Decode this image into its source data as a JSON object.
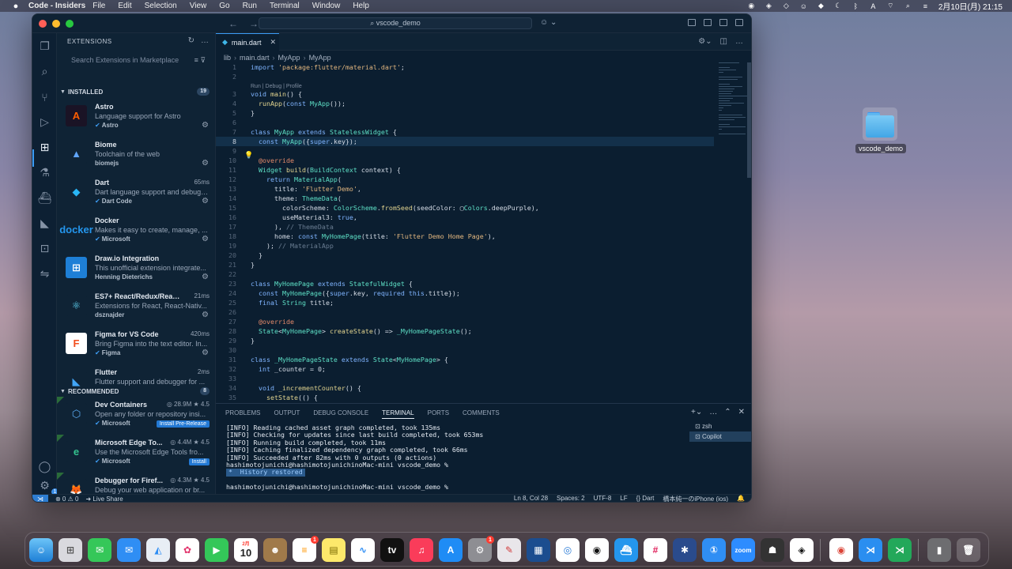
{
  "menubar": {
    "app_name": "Code - Insiders",
    "items": [
      "File",
      "Edit",
      "Selection",
      "View",
      "Go",
      "Run",
      "Terminal",
      "Window",
      "Help"
    ],
    "clock": "2月10日(月) 21:15"
  },
  "desktop": {
    "folder_label": "vscode_demo"
  },
  "titlebar": {
    "search_text": "vscode_demo"
  },
  "sidebar": {
    "title": "EXTENSIONS",
    "search_placeholder": "Search Extensions in Marketplace",
    "installed_label": "INSTALLED",
    "installed_count": "19",
    "recommended_label": "RECOMMENDED",
    "recommended_count": "8",
    "installed": [
      {
        "name": "Astro",
        "desc": "Language support for Astro",
        "publisher": "Astro",
        "verified": true,
        "meta": "",
        "logo": "A",
        "logo_bg": "#1a1325",
        "logo_fg": "#ff5d01"
      },
      {
        "name": "Biome",
        "desc": "Toolchain of the web",
        "publisher": "biomejs",
        "verified": false,
        "meta": "",
        "logo": "▲",
        "logo_bg": "#0f2335",
        "logo_fg": "#60a5fa"
      },
      {
        "name": "Dart",
        "desc": "Dart language support and debugg...",
        "publisher": "Dart Code",
        "verified": true,
        "meta": "65ms",
        "logo": "◆",
        "logo_bg": "#0f2335",
        "logo_fg": "#29b6f6"
      },
      {
        "name": "Docker",
        "desc": "Makes it easy to create, manage, ...",
        "publisher": "Microsoft",
        "verified": true,
        "meta": "",
        "logo": "docker",
        "logo_bg": "#0f2335",
        "logo_fg": "#2496ed"
      },
      {
        "name": "Draw.io Integration",
        "desc": "This unofficial extension integrate...",
        "publisher": "Henning Dieterichs",
        "verified": false,
        "meta": "",
        "logo": "⊞",
        "logo_bg": "#1e7fd6",
        "logo_fg": "#ffffff"
      },
      {
        "name": "ES7+ React/Redux/React...",
        "desc": "Extensions for React, React-Nativ...",
        "publisher": "dsznajder",
        "verified": false,
        "meta": "21ms",
        "logo": "⚛",
        "logo_bg": "#0f2335",
        "logo_fg": "#61dafb"
      },
      {
        "name": "Figma for VS Code",
        "desc": "Bring Figma into the text editor. In...",
        "publisher": "Figma",
        "verified": true,
        "meta": "420ms",
        "logo": "F",
        "logo_bg": "#ffffff",
        "logo_fg": "#f24e1e"
      },
      {
        "name": "Flutter",
        "desc": "Flutter support and debugger for ...",
        "publisher": "",
        "verified": false,
        "meta": "2ms",
        "logo": "◣",
        "logo_bg": "#0f2335",
        "logo_fg": "#42a5f5"
      }
    ],
    "recommended": [
      {
        "name": "Dev Containers",
        "desc": "Open any folder or repository insi...",
        "publisher": "Microsoft",
        "verified": true,
        "meta": "◎ 28.9M ★ 4.5",
        "install": "Install Pre-Release",
        "logo": "⬡",
        "logo_bg": "#0f2335",
        "logo_fg": "#5aa9f0"
      },
      {
        "name": "Microsoft Edge To...",
        "desc": "Use the Microsoft Edge Tools fro...",
        "publisher": "Microsoft",
        "verified": true,
        "meta": "◎ 4.4M ★ 4.5",
        "install": "Install",
        "logo": "e",
        "logo_bg": "#0f2335",
        "logo_fg": "#34c38f"
      },
      {
        "name": "Debugger for Firef...",
        "desc": "Debug your web application or br...",
        "publisher": "Firefox DevTools",
        "verified": false,
        "meta": "◎ 4.3M ★ 4.5",
        "install": "Install",
        "logo": "🦊",
        "logo_bg": "#0f2335",
        "logo_fg": "#ff7139"
      }
    ]
  },
  "editor": {
    "tab_label": "main.dart",
    "breadcrumb": [
      "lib",
      "main.dart",
      "MyApp",
      "MyApp"
    ],
    "codelens": "Run | Debug | Profile",
    "lines": [
      {
        "n": "1",
        "html": "<span class='kw'>import</span> <span class='str'>'package:flutter/material.dart'</span>;"
      },
      {
        "n": "2",
        "html": ""
      },
      {
        "n": "3",
        "html": "<span class='kw'>void</span> <span class='fn'>main</span>() {"
      },
      {
        "n": "4",
        "html": "  <span class='fn'>runApp</span>(<span class='kw'>const</span> <span class='cls'>MyApp</span>());"
      },
      {
        "n": "5",
        "html": "}"
      },
      {
        "n": "6",
        "html": ""
      },
      {
        "n": "7",
        "html": "<span class='kw'>class</span> <span class='cls'>MyApp</span> <span class='kw'>extends</span> <span class='cls'>StatelessWidget</span> {"
      },
      {
        "n": "8",
        "html": "  <span class='kw'>const</span> <span class='cls'>MyApp</span>({<span class='kw'>super</span>.key});"
      },
      {
        "n": "9",
        "html": ""
      },
      {
        "n": "10",
        "html": "  <span class='ann'>@override</span>"
      },
      {
        "n": "11",
        "html": "  <span class='cls'>Widget</span> <span class='fn'>build</span>(<span class='cls'>BuildContext</span> context) {"
      },
      {
        "n": "12",
        "html": "    <span class='kw'>return</span> <span class='cls'>MaterialApp</span>("
      },
      {
        "n": "13",
        "html": "      title: <span class='str'>'Flutter Demo'</span>,"
      },
      {
        "n": "14",
        "html": "      theme: <span class='cls'>ThemeData</span>("
      },
      {
        "n": "15",
        "html": "        colorScheme: <span class='cls'>ColorScheme</span>.<span class='fn'>fromSeed</span>(seedColor: ▢<span class='cls'>Colors</span>.deepPurple),"
      },
      {
        "n": "16",
        "html": "        useMaterial3: <span class='kw'>true</span>,"
      },
      {
        "n": "17",
        "html": "      ), <span class='cm'>// ThemeData</span>"
      },
      {
        "n": "18",
        "html": "      home: <span class='kw'>const</span> <span class='cls'>MyHomePage</span>(title: <span class='str'>'Flutter Demo Home Page'</span>),"
      },
      {
        "n": "19",
        "html": "    ); <span class='cm'>// MaterialApp</span>"
      },
      {
        "n": "20",
        "html": "  }"
      },
      {
        "n": "21",
        "html": "}"
      },
      {
        "n": "22",
        "html": ""
      },
      {
        "n": "23",
        "html": "<span class='kw'>class</span> <span class='cls'>MyHomePage</span> <span class='kw'>extends</span> <span class='cls'>StatefulWidget</span> {"
      },
      {
        "n": "24",
        "html": "  <span class='kw'>const</span> <span class='cls'>MyHomePage</span>({<span class='kw'>super</span>.key, <span class='kw'>required</span> <span class='kw'>this</span>.title});"
      },
      {
        "n": "25",
        "html": "  <span class='kw'>final</span> <span class='cls'>String</span> title;"
      },
      {
        "n": "26",
        "html": ""
      },
      {
        "n": "27",
        "html": "  <span class='ann'>@override</span>"
      },
      {
        "n": "28",
        "html": "  <span class='cls'>State</span>&lt;<span class='cls'>MyHomePage</span>&gt; <span class='fn'>createState</span>() =&gt; <span class='cls'>_MyHomePageState</span>();"
      },
      {
        "n": "29",
        "html": "}"
      },
      {
        "n": "30",
        "html": ""
      },
      {
        "n": "31",
        "html": "<span class='kw'>class</span> <span class='cls'>_MyHomePageState</span> <span class='kw'>extends</span> <span class='cls'>State</span>&lt;<span class='cls'>MyHomePage</span>&gt; {"
      },
      {
        "n": "32",
        "html": "  <span class='kw'>int</span> _counter = 0;"
      },
      {
        "n": "33",
        "html": ""
      },
      {
        "n": "34",
        "html": "  <span class='kw'>void</span> <span class='fn'>_incrementCounter</span>() {"
      },
      {
        "n": "35",
        "html": "    <span class='fn'>setState</span>(() {"
      }
    ]
  },
  "panel": {
    "tabs": [
      "PROBLEMS",
      "OUTPUT",
      "DEBUG CONSOLE",
      "TERMINAL",
      "PORTS",
      "COMMENTS"
    ],
    "active_tab": "TERMINAL",
    "terminal_lines": [
      "[INFO] Reading cached asset graph completed, took 135ms",
      "[INFO] Checking for updates since last build completed, took 653ms",
      "[INFO] Running build completed, took 11ms",
      "[INFO] Caching finalized dependency graph completed, took 66ms",
      "[INFO] Succeeded after 82ms with 0 outputs (0 actions)",
      "hashimotojunichi@hashimotojunichinoMac-mini vscode_demo %"
    ],
    "history_restored": "*  History restored",
    "prompt": "hashimotojunichi@hashimotojunichinoMac-mini vscode_demo %",
    "terminals": [
      "zsh",
      "Copilot"
    ]
  },
  "statusbar": {
    "problems": "⊗ 0 ⚠ 0",
    "live_share": "Live Share",
    "position": "Ln 8, Col 28",
    "spaces": "Spaces: 2",
    "encoding": "UTF-8",
    "eol": "LF",
    "language": "Dart",
    "device": "橋本純一のiPhone (ios)"
  },
  "dock": {
    "calendar_month": "2月",
    "calendar_day": "10",
    "zoom_label": "zoom"
  }
}
